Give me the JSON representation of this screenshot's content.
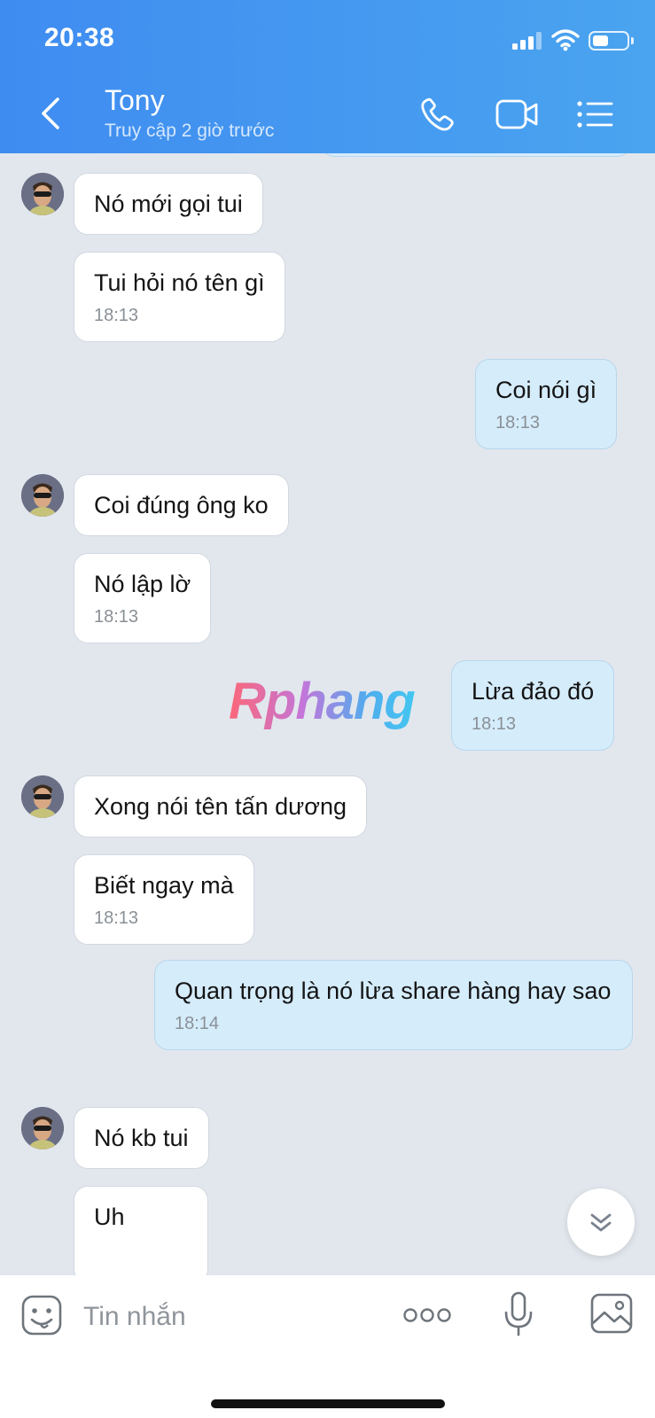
{
  "status_bar": {
    "time": "20:38"
  },
  "header": {
    "contact_name": "Tony",
    "contact_status": "Truy cập 2 giờ trước",
    "icons": [
      "back-icon",
      "phone-icon",
      "video-icon",
      "list-icon"
    ]
  },
  "messages": [
    {
      "direction": "in",
      "text": "Nó mới gọi tui",
      "time": ""
    },
    {
      "direction": "in",
      "text": "Tui hỏi nó tên gì",
      "time": "18:13"
    },
    {
      "direction": "out",
      "text": "Coi nói gì",
      "time": "18:13"
    },
    {
      "direction": "in",
      "text": "Coi đúng ông ko",
      "time": ""
    },
    {
      "direction": "in",
      "text": "Nó lập lờ",
      "time": "18:13"
    },
    {
      "direction": "out",
      "text": "Lừa đảo đó",
      "time": "18:13"
    },
    {
      "direction": "in",
      "text": "Xong nói tên tấn dương",
      "time": ""
    },
    {
      "direction": "in",
      "text": "Biết ngay mà",
      "time": "18:13"
    },
    {
      "direction": "out",
      "text": "Quan trọng là nó lừa share hàng hay sao",
      "time": "18:14"
    },
    {
      "direction": "in",
      "text": "Nó kb tui",
      "time": ""
    },
    {
      "direction": "in",
      "text": "Uh",
      "time": ""
    }
  ],
  "watermark": "Rphang",
  "composer": {
    "placeholder": "Tin nhắn"
  },
  "colors": {
    "header_start": "#3f8cf1",
    "header_end": "#4aa4ef",
    "chat_bg": "#e2e7ee",
    "outgoing_bubble": "#d5ecfb",
    "incoming_bubble": "#ffffff"
  }
}
